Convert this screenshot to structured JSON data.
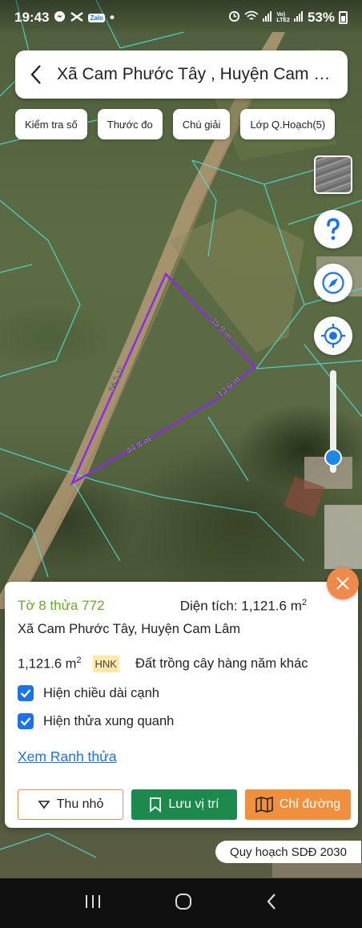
{
  "status_bar": {
    "time": "19:43",
    "dot": "•",
    "network_label": "Vo)\nLTE2",
    "battery": "53%"
  },
  "header": {
    "title": "Xã Cam Phước Tây , Huyện Cam L…"
  },
  "toolbar": {
    "chips": [
      {
        "label": "Kiểm tra số"
      },
      {
        "label": "Thước đo"
      },
      {
        "label": "Chú giải"
      },
      {
        "label": "Lớp Q.Hoạch(5)"
      }
    ]
  },
  "map": {
    "edge_labels": [
      "35.9 m",
      "13.6 m",
      "44.8 m",
      "64.1 m"
    ],
    "parcel_color": "#8b2be2",
    "zoom_level": 0.15
  },
  "parcel_panel": {
    "parcel_id": "Tờ 8 thửa 772",
    "area_label": "Diện tích: 1,121.6 m",
    "area_superscript": "2",
    "address": "Xã Cam Phước Tây, Huyện Cam Lâm",
    "area_value": "1,121.6 m",
    "area_value_superscript": "2",
    "land_code": "HNK",
    "land_type": "Đất trồng cây hàng năm khác",
    "option_show_edges": "Hiện chiều dài cạnh",
    "option_show_neighbors": "Hiện thửa xung quanh",
    "link_boundary": "Xem Ranh thửa",
    "collapse_label": "Thu nhỏ",
    "save_label": "Lưu vị trí",
    "directions_label": "Chỉ đường",
    "show_edges_checked": true,
    "show_neighbors_checked": true
  },
  "planning_tag": "Quy hoạch SDĐ 2030",
  "colors": {
    "accent_blue": "#1a73e8",
    "parcel_green": "#6aa82a",
    "save_green": "#1b8a4c",
    "orange": "#f0903f"
  }
}
